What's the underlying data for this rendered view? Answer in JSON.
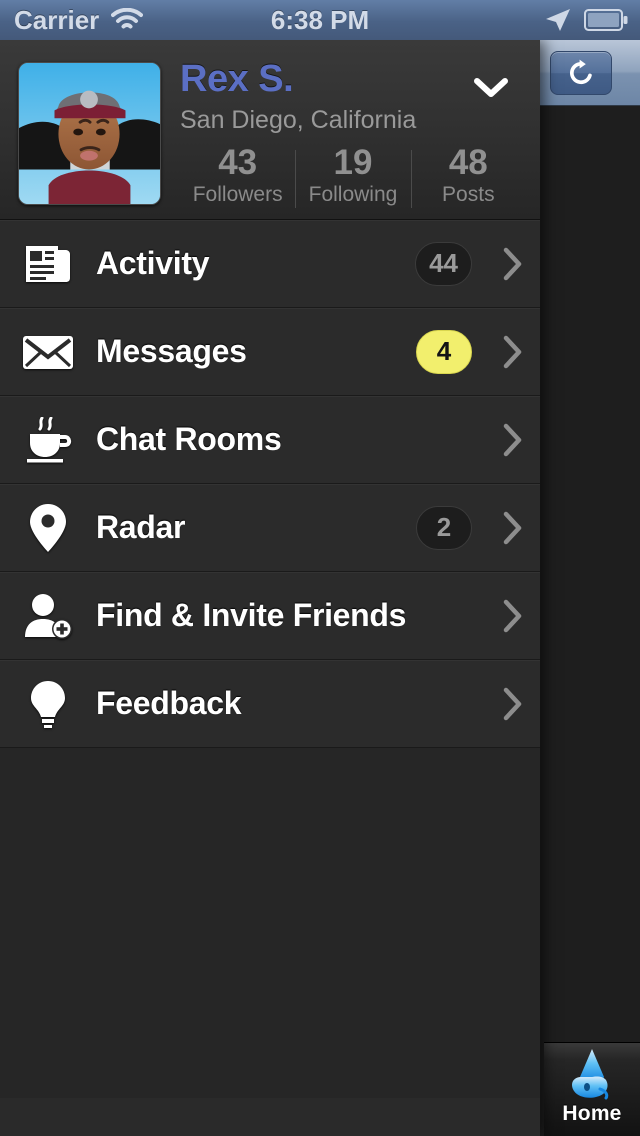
{
  "status_bar": {
    "carrier": "Carrier",
    "time": "6:38 PM",
    "wifi_icon": "wifi-icon",
    "location_icon": "location-arrow-icon",
    "battery_icon": "battery-icon"
  },
  "profile": {
    "name": "Rex S.",
    "location": "San Diego, California",
    "avatar_icon": "avatar",
    "disclosure_icon": "chevron-down-icon",
    "name_color": "#5b6fc4",
    "stats": [
      {
        "value": "43",
        "label": "Followers"
      },
      {
        "value": "19",
        "label": "Following"
      },
      {
        "value": "48",
        "label": "Posts"
      }
    ]
  },
  "menu": {
    "items": [
      {
        "label": "Activity",
        "icon": "newspaper-icon",
        "badge": "44",
        "badge_style": "dark",
        "chevron": "chevron-right-icon"
      },
      {
        "label": "Messages",
        "icon": "envelope-icon",
        "badge": "4",
        "badge_style": "yellow",
        "chevron": "chevron-right-icon"
      },
      {
        "label": "Chat Rooms",
        "icon": "coffee-cup-icon",
        "badge": "",
        "badge_style": "none",
        "chevron": "chevron-right-icon"
      },
      {
        "label": "Radar",
        "icon": "map-pin-icon",
        "badge": "2",
        "badge_style": "dark",
        "chevron": "chevron-right-icon"
      },
      {
        "label": "Find & Invite Friends",
        "icon": "person-plus-icon",
        "badge": "",
        "badge_style": "none",
        "chevron": "chevron-right-icon"
      },
      {
        "label": "Feedback",
        "icon": "lightbulb-icon",
        "badge": "",
        "badge_style": "none",
        "chevron": "chevron-right-icon"
      }
    ]
  },
  "right_panel": {
    "refresh_icon": "refresh-icon",
    "badge_color": "#f2ef6d"
  },
  "tab_bar": {
    "items": [
      {
        "label": "Home",
        "icon": "home-elephant-icon",
        "selected": true
      }
    ]
  }
}
